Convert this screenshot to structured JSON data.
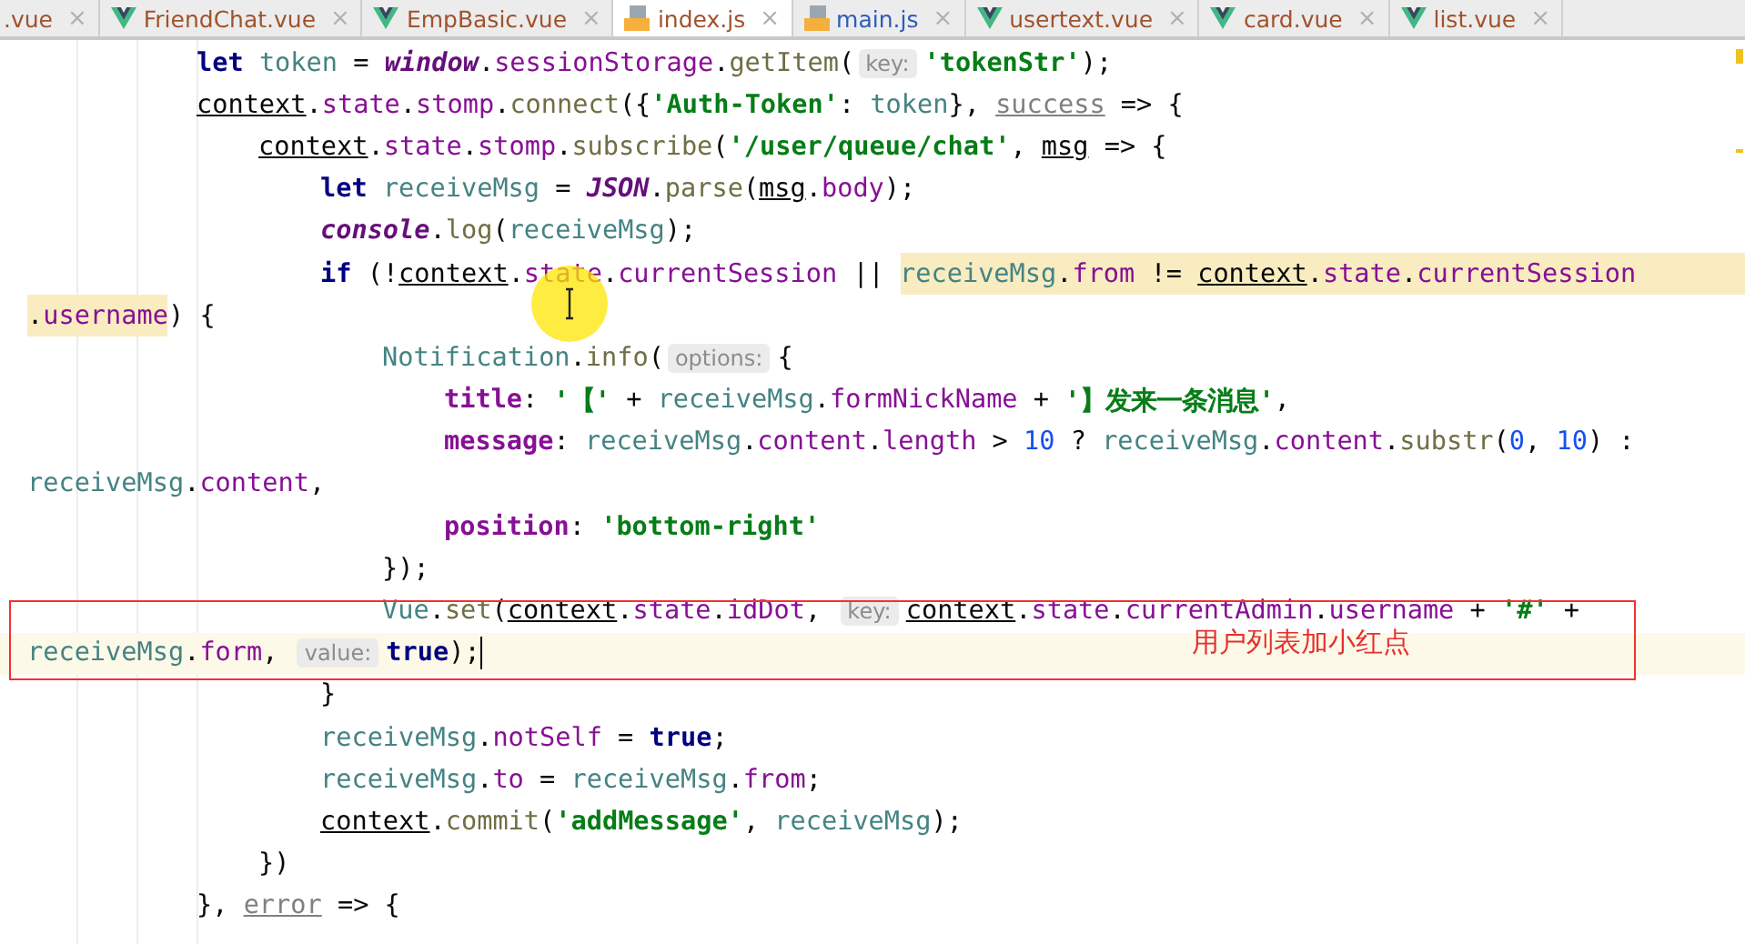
{
  "tabs": [
    {
      "label": ".vue",
      "kind": "plain",
      "color": "#a0522d",
      "selected": false
    },
    {
      "label": "FriendChat.vue",
      "kind": "vue",
      "color": "#a0522d",
      "selected": false
    },
    {
      "label": "EmpBasic.vue",
      "kind": "vue",
      "color": "#a0522d",
      "selected": false
    },
    {
      "label": "index.js",
      "kind": "js",
      "color": "#a0522d",
      "selected": true
    },
    {
      "label": "main.js",
      "kind": "js",
      "color": "#2e5cb8",
      "selected": false
    },
    {
      "label": "usertext.vue",
      "kind": "vue",
      "color": "#a0522d",
      "selected": false
    },
    {
      "label": "card.vue",
      "kind": "vue",
      "color": "#a0522d",
      "selected": false
    },
    {
      "label": "list.vue",
      "kind": "vue",
      "color": "#a0522d",
      "selected": false
    }
  ],
  "close_glyph": "×",
  "code": [
    {
      "kind": "code",
      "current": false,
      "segments": [
        {
          "highlighted": false,
          "tokens": [
            {
              "kind": "kw",
              "text": "let "
            },
            {
              "kind": "var",
              "text": "token"
            },
            {
              "kind": "op",
              "text": " = "
            },
            {
              "kind": "glob",
              "text": "window"
            },
            {
              "kind": "op",
              "text": "."
            },
            {
              "kind": "prop",
              "text": "sessionStorage"
            },
            {
              "kind": "op",
              "text": "."
            },
            {
              "kind": "fn",
              "text": "getItem"
            },
            {
              "kind": "op",
              "text": "("
            },
            {
              "kind": "hint",
              "text": "key:"
            },
            {
              "kind": "str",
              "text": "'tokenStr'"
            },
            {
              "kind": "op",
              "text": ");"
            }
          ]
        }
      ]
    },
    {
      "kind": "code",
      "current": false,
      "segments": [
        {
          "highlighted": false,
          "tokens": [
            {
              "kind": "ref",
              "text": "context"
            },
            {
              "kind": "op",
              "text": "."
            },
            {
              "kind": "prop",
              "text": "state"
            },
            {
              "kind": "op",
              "text": "."
            },
            {
              "kind": "prop",
              "text": "stomp"
            },
            {
              "kind": "op",
              "text": "."
            },
            {
              "kind": "fn",
              "text": "connect"
            },
            {
              "kind": "op",
              "text": "({"
            },
            {
              "kind": "str",
              "text": "'Auth-Token'"
            },
            {
              "kind": "op",
              "text": ": "
            },
            {
              "kind": "var",
              "text": "token"
            },
            {
              "kind": "op",
              "text": "}, "
            },
            {
              "kind": "param",
              "text": "success"
            },
            {
              "kind": "op",
              "text": " => {"
            }
          ]
        }
      ],
      "children": [
        {
          "kind": "code",
          "current": false,
          "segments": [
            {
              "highlighted": false,
              "tokens": [
                {
                  "kind": "ref",
                  "text": "context"
                },
                {
                  "kind": "op",
                  "text": "."
                },
                {
                  "kind": "prop",
                  "text": "state"
                },
                {
                  "kind": "op",
                  "text": "."
                },
                {
                  "kind": "prop",
                  "text": "stomp"
                },
                {
                  "kind": "op",
                  "text": "."
                },
                {
                  "kind": "fn",
                  "text": "subscribe"
                },
                {
                  "kind": "op",
                  "text": "("
                },
                {
                  "kind": "str",
                  "text": "'/user/queue/chat'"
                },
                {
                  "kind": "op",
                  "text": ", "
                },
                {
                  "kind": "ref",
                  "text": "msg"
                },
                {
                  "kind": "op",
                  "text": " => {"
                }
              ]
            }
          ],
          "children": [
            {
              "kind": "code",
              "current": false,
              "segments": [
                {
                  "highlighted": false,
                  "tokens": [
                    {
                      "kind": "kw",
                      "text": "let "
                    },
                    {
                      "kind": "var",
                      "text": "receiveMsg"
                    },
                    {
                      "kind": "op",
                      "text": " = "
                    },
                    {
                      "kind": "glob",
                      "text": "JSON"
                    },
                    {
                      "kind": "op",
                      "text": "."
                    },
                    {
                      "kind": "fn",
                      "text": "parse"
                    },
                    {
                      "kind": "op",
                      "text": "("
                    },
                    {
                      "kind": "ref",
                      "text": "msg"
                    },
                    {
                      "kind": "op",
                      "text": "."
                    },
                    {
                      "kind": "prop",
                      "text": "body"
                    },
                    {
                      "kind": "op",
                      "text": ");"
                    }
                  ]
                }
              ]
            },
            {
              "kind": "code",
              "current": false,
              "segments": [
                {
                  "highlighted": false,
                  "tokens": [
                    {
                      "kind": "glob",
                      "text": "console"
                    },
                    {
                      "kind": "op",
                      "text": "."
                    },
                    {
                      "kind": "fn",
                      "text": "log"
                    },
                    {
                      "kind": "op",
                      "text": "("
                    },
                    {
                      "kind": "var",
                      "text": "receiveMsg"
                    },
                    {
                      "kind": "op",
                      "text": ");"
                    }
                  ]
                }
              ]
            },
            {
              "kind": "code",
              "current": false,
              "segments": [
                {
                  "highlighted": false,
                  "tokens": [
                    {
                      "kind": "kw",
                      "text": "if "
                    },
                    {
                      "kind": "op",
                      "text": "(!"
                    },
                    {
                      "kind": "ref",
                      "text": "context"
                    },
                    {
                      "kind": "op",
                      "text": "."
                    },
                    {
                      "kind": "prop",
                      "text": "state"
                    },
                    {
                      "kind": "op",
                      "text": "."
                    },
                    {
                      "kind": "prop",
                      "text": "currentSession"
                    },
                    {
                      "kind": "op",
                      "text": " || "
                    }
                  ]
                },
                {
                  "highlighted": true,
                  "tokens": [
                    {
                      "kind": "var",
                      "text": "receiveMsg"
                    },
                    {
                      "kind": "op",
                      "text": "."
                    },
                    {
                      "kind": "prop",
                      "text": "from"
                    },
                    {
                      "kind": "op",
                      "text": " != "
                    },
                    {
                      "kind": "ref",
                      "text": "context"
                    },
                    {
                      "kind": "op",
                      "text": "."
                    },
                    {
                      "kind": "prop",
                      "text": "state"
                    },
                    {
                      "kind": "op",
                      "text": "."
                    },
                    {
                      "kind": "prop",
                      "text": "currentSession"
                    }
                  ]
                }
              ],
              "children": [
                {
                  "kind": "wrap",
                  "current": false,
                  "segments": [
                    {
                      "highlighted": true,
                      "tokens": [
                        {
                          "kind": "op",
                          "text": "."
                        },
                        {
                          "kind": "prop",
                          "text": "username"
                        }
                      ]
                    },
                    {
                      "highlighted": false,
                      "tokens": [
                        {
                          "kind": "op",
                          "text": ") {"
                        }
                      ]
                    }
                  ]
                },
                {
                  "kind": "code",
                  "current": false,
                  "segments": [
                    {
                      "highlighted": false,
                      "tokens": [
                        {
                          "kind": "var",
                          "text": "Notification"
                        },
                        {
                          "kind": "op",
                          "text": "."
                        },
                        {
                          "kind": "fn",
                          "text": "info"
                        },
                        {
                          "kind": "op",
                          "text": "("
                        },
                        {
                          "kind": "hint",
                          "text": "options:"
                        },
                        {
                          "kind": "op",
                          "text": "{"
                        }
                      ]
                    }
                  ],
                  "children": [
                    {
                      "kind": "code",
                      "current": false,
                      "segments": [
                        {
                          "highlighted": false,
                          "tokens": [
                            {
                              "kind": "field",
                              "text": "title"
                            },
                            {
                              "kind": "op",
                              "text": ": "
                            },
                            {
                              "kind": "str",
                              "text": "'【'"
                            },
                            {
                              "kind": "op",
                              "text": " + "
                            },
                            {
                              "kind": "var",
                              "text": "receiveMsg"
                            },
                            {
                              "kind": "op",
                              "text": "."
                            },
                            {
                              "kind": "prop",
                              "text": "formNickName"
                            },
                            {
                              "kind": "op",
                              "text": " + "
                            },
                            {
                              "kind": "str",
                              "text": "'】发来一条消息'"
                            },
                            {
                              "kind": "op",
                              "text": ","
                            }
                          ]
                        }
                      ]
                    },
                    {
                      "kind": "code",
                      "current": false,
                      "segments": [
                        {
                          "highlighted": false,
                          "tokens": [
                            {
                              "kind": "field",
                              "text": "message"
                            },
                            {
                              "kind": "op",
                              "text": ": "
                            },
                            {
                              "kind": "var",
                              "text": "receiveMsg"
                            },
                            {
                              "kind": "op",
                              "text": "."
                            },
                            {
                              "kind": "prop",
                              "text": "content"
                            },
                            {
                              "kind": "op",
                              "text": "."
                            },
                            {
                              "kind": "prop",
                              "text": "length"
                            },
                            {
                              "kind": "op",
                              "text": " > "
                            },
                            {
                              "kind": "num",
                              "text": "10"
                            },
                            {
                              "kind": "op",
                              "text": " ? "
                            },
                            {
                              "kind": "var",
                              "text": "receiveMsg"
                            },
                            {
                              "kind": "op",
                              "text": "."
                            },
                            {
                              "kind": "prop",
                              "text": "content"
                            },
                            {
                              "kind": "op",
                              "text": "."
                            },
                            {
                              "kind": "fn",
                              "text": "substr"
                            },
                            {
                              "kind": "op",
                              "text": "("
                            },
                            {
                              "kind": "num",
                              "text": "0"
                            },
                            {
                              "kind": "op",
                              "text": ", "
                            },
                            {
                              "kind": "num",
                              "text": "10"
                            },
                            {
                              "kind": "op",
                              "text": ") :"
                            }
                          ]
                        }
                      ]
                    },
                    {
                      "kind": "wrap",
                      "current": false,
                      "segments": [
                        {
                          "highlighted": false,
                          "tokens": [
                            {
                              "kind": "var",
                              "text": "receiveMsg"
                            },
                            {
                              "kind": "op",
                              "text": "."
                            },
                            {
                              "kind": "prop",
                              "text": "content"
                            },
                            {
                              "kind": "op",
                              "text": ","
                            }
                          ]
                        }
                      ]
                    },
                    {
                      "kind": "code",
                      "current": false,
                      "segments": [
                        {
                          "highlighted": false,
                          "tokens": [
                            {
                              "kind": "field",
                              "text": "position"
                            },
                            {
                              "kind": "op",
                              "text": ": "
                            },
                            {
                              "kind": "str",
                              "text": "'bottom-right'"
                            }
                          ]
                        }
                      ]
                    }
                  ]
                },
                {
                  "kind": "code",
                  "current": false,
                  "segments": [
                    {
                      "highlighted": false,
                      "tokens": [
                        {
                          "kind": "op",
                          "text": "});"
                        }
                      ]
                    }
                  ]
                },
                {
                  "kind": "code",
                  "current": false,
                  "segments": [
                    {
                      "highlighted": false,
                      "tokens": [
                        {
                          "kind": "var",
                          "text": "Vue"
                        },
                        {
                          "kind": "op",
                          "text": "."
                        },
                        {
                          "kind": "fn",
                          "text": "set"
                        },
                        {
                          "kind": "op",
                          "text": "("
                        },
                        {
                          "kind": "ref",
                          "text": "context"
                        },
                        {
                          "kind": "op",
                          "text": "."
                        },
                        {
                          "kind": "prop",
                          "text": "state"
                        },
                        {
                          "kind": "op",
                          "text": "."
                        },
                        {
                          "kind": "prop",
                          "text": "idDot"
                        },
                        {
                          "kind": "op",
                          "text": ", "
                        },
                        {
                          "kind": "hint",
                          "text": "key:"
                        },
                        {
                          "kind": "ref",
                          "text": "context"
                        },
                        {
                          "kind": "op",
                          "text": "."
                        },
                        {
                          "kind": "prop",
                          "text": "state"
                        },
                        {
                          "kind": "op",
                          "text": "."
                        },
                        {
                          "kind": "prop",
                          "text": "currentAdmin"
                        },
                        {
                          "kind": "op",
                          "text": "."
                        },
                        {
                          "kind": "prop",
                          "text": "username"
                        },
                        {
                          "kind": "op",
                          "text": " + "
                        },
                        {
                          "kind": "str",
                          "text": "'#'"
                        },
                        {
                          "kind": "op",
                          "text": " +"
                        }
                      ]
                    }
                  ]
                },
                {
                  "kind": "wrap",
                  "current": true,
                  "segments": [
                    {
                      "highlighted": false,
                      "tokens": [
                        {
                          "kind": "var",
                          "text": "receiveMsg"
                        },
                        {
                          "kind": "op",
                          "text": "."
                        },
                        {
                          "kind": "prop",
                          "text": "form"
                        },
                        {
                          "kind": "op",
                          "text": ", "
                        },
                        {
                          "kind": "hint",
                          "text": "value:"
                        },
                        {
                          "kind": "kw",
                          "text": "true"
                        },
                        {
                          "kind": "op",
                          "text": ");"
                        }
                      ]
                    }
                  ]
                }
              ]
            },
            {
              "kind": "code",
              "current": false,
              "segments": [
                {
                  "highlighted": false,
                  "tokens": [
                    {
                      "kind": "op",
                      "text": "}"
                    }
                  ]
                }
              ]
            },
            {
              "kind": "code",
              "current": false,
              "segments": [
                {
                  "highlighted": false,
                  "tokens": [
                    {
                      "kind": "var",
                      "text": "receiveMsg"
                    },
                    {
                      "kind": "op",
                      "text": "."
                    },
                    {
                      "kind": "prop",
                      "text": "notSelf"
                    },
                    {
                      "kind": "op",
                      "text": " = "
                    },
                    {
                      "kind": "kw",
                      "text": "true"
                    },
                    {
                      "kind": "op",
                      "text": ";"
                    }
                  ]
                }
              ]
            },
            {
              "kind": "code",
              "current": false,
              "segments": [
                {
                  "highlighted": false,
                  "tokens": [
                    {
                      "kind": "var",
                      "text": "receiveMsg"
                    },
                    {
                      "kind": "op",
                      "text": "."
                    },
                    {
                      "kind": "prop",
                      "text": "to"
                    },
                    {
                      "kind": "op",
                      "text": " = "
                    },
                    {
                      "kind": "var",
                      "text": "receiveMsg"
                    },
                    {
                      "kind": "op",
                      "text": "."
                    },
                    {
                      "kind": "prop",
                      "text": "from"
                    },
                    {
                      "kind": "op",
                      "text": ";"
                    }
                  ]
                }
              ]
            },
            {
              "kind": "code",
              "current": false,
              "segments": [
                {
                  "highlighted": false,
                  "tokens": [
                    {
                      "kind": "ref",
                      "text": "context"
                    },
                    {
                      "kind": "op",
                      "text": "."
                    },
                    {
                      "kind": "fn",
                      "text": "commit"
                    },
                    {
                      "kind": "op",
                      "text": "("
                    },
                    {
                      "kind": "str",
                      "text": "'addMessage'"
                    },
                    {
                      "kind": "op",
                      "text": ", "
                    },
                    {
                      "kind": "var",
                      "text": "receiveMsg"
                    },
                    {
                      "kind": "op",
                      "text": ");"
                    }
                  ]
                }
              ]
            }
          ]
        },
        {
          "kind": "code",
          "current": false,
          "segments": [
            {
              "highlighted": false,
              "tokens": [
                {
                  "kind": "op",
                  "text": "})"
                }
              ]
            }
          ]
        }
      ]
    },
    {
      "kind": "code",
      "current": false,
      "segments": [
        {
          "highlighted": false,
          "tokens": [
            {
              "kind": "op",
              "text": "}, "
            },
            {
              "kind": "param",
              "text": "error"
            },
            {
              "kind": "op",
              "text": " => {"
            }
          ]
        }
      ]
    }
  ],
  "annotation": {
    "text": "用户列表加小红点"
  }
}
